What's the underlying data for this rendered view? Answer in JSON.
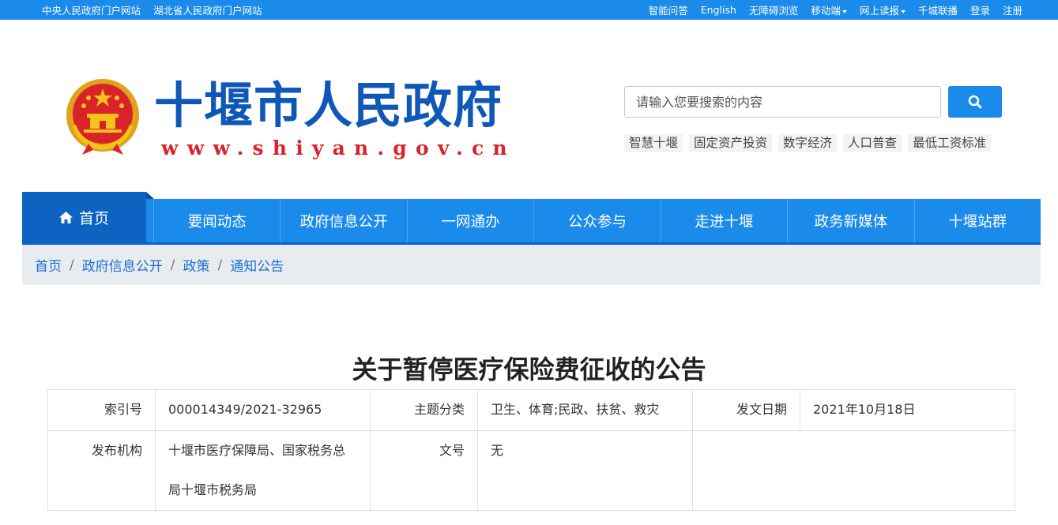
{
  "topbar": {
    "left_links": [
      "中央人民政府门户网站",
      "湖北省人民政府门户网站"
    ],
    "right_links": [
      {
        "label": "智能问答",
        "dropdown": false
      },
      {
        "label": "English",
        "dropdown": false
      },
      {
        "label": "无障碍浏览",
        "dropdown": false
      },
      {
        "label": "移动端",
        "dropdown": true
      },
      {
        "label": "网上读报",
        "dropdown": true
      },
      {
        "label": "千城联播",
        "dropdown": false
      },
      {
        "label": "登录",
        "dropdown": false
      },
      {
        "label": "注册",
        "dropdown": false
      }
    ]
  },
  "header": {
    "site_name": "十堰市人民政府",
    "site_url": "www.shiyan.gov.cn",
    "search": {
      "placeholder": "请输入您要搜索的内容",
      "value": ""
    },
    "hot_links": [
      "智慧十堰",
      "固定资产投资",
      "数字经济",
      "人口普查",
      "最低工资标准"
    ]
  },
  "nav": {
    "home": "首页",
    "items": [
      "要闻动态",
      "政府信息公开",
      "一网通办",
      "公众参与",
      "走进十堰",
      "政务新媒体",
      "十堰站群"
    ]
  },
  "breadcrumb": [
    "首页",
    "政府信息公开",
    "政策",
    "通知公告"
  ],
  "article": {
    "title": "关于暂停医疗保险费征收的公告",
    "meta": {
      "index_label": "索引号",
      "index_value": "000014349/2021-32965",
      "topic_label": "主题分类",
      "topic_value": "卫生、体育;民政、扶贫、救灾",
      "date_label": "发文日期",
      "date_value": "2021年10月18日",
      "issuer_label": "发布机构",
      "issuer_value": "十堰市医疗保障局、国家税务总局十堰市税务局",
      "docno_label": "文号",
      "docno_value": "无"
    }
  },
  "colors": {
    "primary": "#1a8aeb",
    "nav_dark": "#0d63c2",
    "site_name": "#1058b8",
    "site_url": "#d8232a"
  }
}
